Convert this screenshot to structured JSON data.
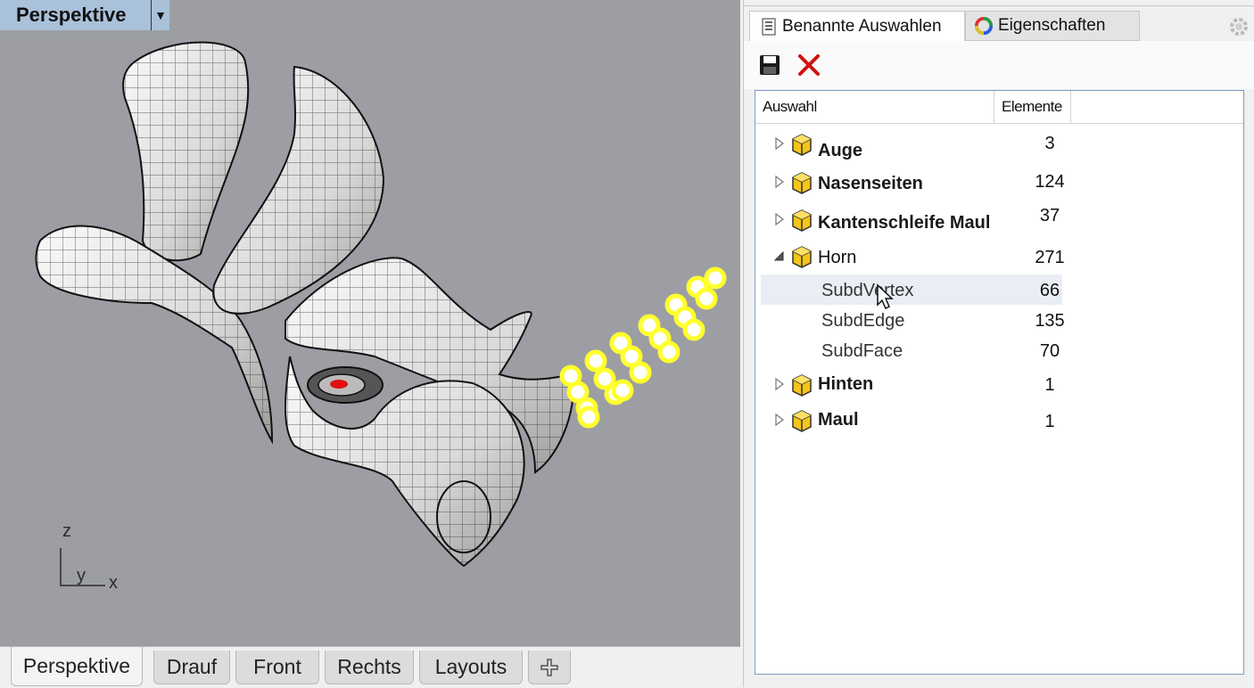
{
  "viewport": {
    "title": "Perspektive",
    "background_color": "#9c9ea4",
    "title_bg_color": "#a9c1d9",
    "axes": {
      "z": "z",
      "y": "y",
      "x": "x"
    },
    "model_accent_color": "#ffff2e"
  },
  "viewport_tabs": [
    {
      "label": "Perspektive"
    },
    {
      "label": "Drauf"
    },
    {
      "label": "Front"
    },
    {
      "label": "Rechts"
    },
    {
      "label": "Layouts"
    }
  ],
  "panel": {
    "tabs": [
      {
        "label": "Benannte Auswahlen",
        "icon": "list-icon"
      },
      {
        "label": "Eigenschaften",
        "icon": "color-wheel-icon"
      }
    ],
    "toolbar": [
      {
        "icon": "save-icon"
      },
      {
        "icon": "delete-icon"
      }
    ],
    "columns": {
      "selection": "Auswahl",
      "elements": "Elemente"
    },
    "rows": [
      {
        "label": "Auge",
        "count": "3"
      },
      {
        "label": "Nasenseiten",
        "count": "124"
      },
      {
        "label": "Kantenschleife Maul",
        "count": "37"
      },
      {
        "label": "Horn",
        "count": "271"
      },
      {
        "label": "SubdVertex",
        "count": "66"
      },
      {
        "label": "SubdEdge",
        "count": "135"
      },
      {
        "label": "SubdFace",
        "count": "70"
      },
      {
        "label": "Hinten",
        "count": "1"
      },
      {
        "label": "Maul",
        "count": "1"
      }
    ]
  }
}
